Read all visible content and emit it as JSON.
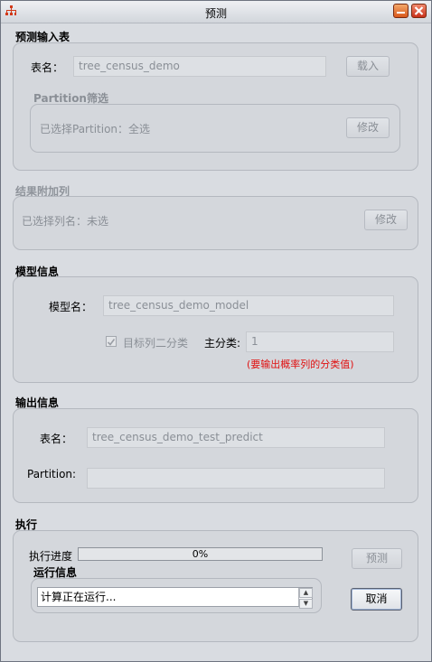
{
  "window": {
    "title": "预测"
  },
  "icons": {
    "app": "org-chart-icon",
    "minimize": "minimize-icon",
    "close": "close-icon"
  },
  "input_section": {
    "title": "预测输入表",
    "table_label": "表名：",
    "table_value": "tree_census_demo",
    "load_button": "载入",
    "partition": {
      "title": "Partition筛选",
      "selected_text": "已选择Partition：全选",
      "modify_button": "修改"
    }
  },
  "append_section": {
    "title": "结果附加列",
    "selected_text": "已选择列名：未选",
    "modify_button": "修改"
  },
  "model_section": {
    "title": "模型信息",
    "model_label": "模型名：",
    "model_value": "tree_census_demo_model",
    "binary_checkbox_label": "目标列二分类",
    "binary_checked": true,
    "main_class_label": "主分类:",
    "main_class_value": "1",
    "hint": "(要输出概率列的分类值)"
  },
  "output_section": {
    "title": "输出信息",
    "table_label": "表名：",
    "table_value": "tree_census_demo_test_predict",
    "partition_label": "Partition:",
    "partition_value": ""
  },
  "exec_section": {
    "title": "执行",
    "progress_label": "执行进度",
    "progress_value": 0,
    "progress_text": "0%",
    "predict_button": "预测",
    "run_info_title": "运行信息",
    "run_info_value": "计算正在运行...",
    "cancel_button": "取消"
  },
  "colors": {
    "accent_red": "#e01010",
    "close_button": "#c8301a"
  }
}
